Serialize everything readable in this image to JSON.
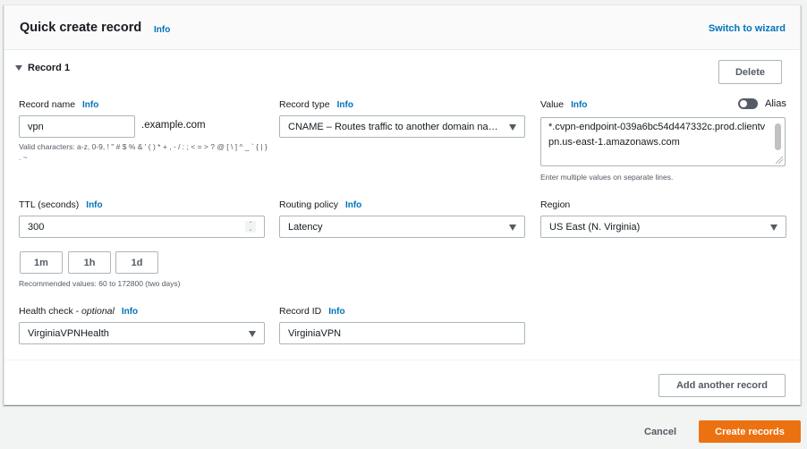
{
  "header": {
    "title": "Quick create record",
    "info_label": "Info",
    "switch_label": "Switch to wizard"
  },
  "record": {
    "title": "Record 1",
    "delete_label": "Delete",
    "record_name": {
      "label": "Record name",
      "info": "Info",
      "value": "vpn",
      "suffix": ".example.com",
      "hint": "Valid characters: a-z, 0-9, ! \" # $ % & ' ( ) * + , - / : ; < = > ? @ [ \\ ] ^ _ ` { | } . ~"
    },
    "record_type": {
      "label": "Record type",
      "info": "Info",
      "selected": "CNAME – Routes traffic to another domain name and to some AWS resources"
    },
    "value": {
      "label": "Value",
      "info": "Info",
      "text": "*.cvpn-endpoint-039a6bc54d447332c.prod.clientvpn.us-east-1.amazonaws.com",
      "hint": "Enter multiple values on separate lines."
    },
    "alias": {
      "label": "Alias",
      "enabled": false
    },
    "ttl": {
      "label": "TTL (seconds)",
      "info": "Info",
      "value": "300",
      "presets": [
        "1m",
        "1h",
        "1d"
      ],
      "hint": "Recommended values: 60 to 172800 (two days)"
    },
    "routing_policy": {
      "label": "Routing policy",
      "info": "Info",
      "selected": "Latency"
    },
    "region": {
      "label": "Region",
      "selected": "US East (N. Virginia)"
    },
    "health_check": {
      "label": "Health check -",
      "optional": "optional",
      "info": "Info",
      "selected": "VirginiaVPNHealth"
    },
    "record_id": {
      "label": "Record ID",
      "info": "Info",
      "value": "VirginiaVPN"
    }
  },
  "footer": {
    "add_label": "Add another record",
    "cancel_label": "Cancel",
    "create_label": "Create records"
  },
  "colors": {
    "accent": "#ec7211",
    "link": "#0073bb",
    "background": "#f2f3f3"
  }
}
